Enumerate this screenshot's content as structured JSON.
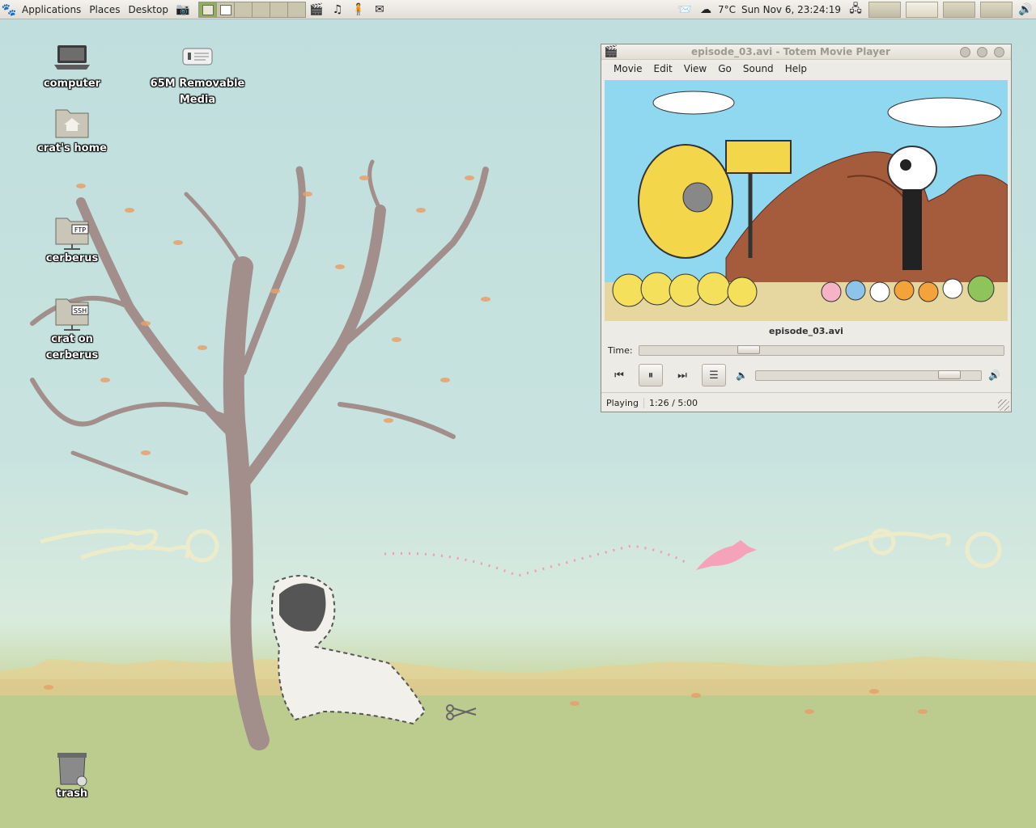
{
  "panel": {
    "menus": [
      "Applications",
      "Places",
      "Desktop"
    ],
    "weather": "7°C",
    "clock": "Sun Nov  6, 23:24:19"
  },
  "desktop_icons": [
    {
      "id": "computer",
      "label": "computer",
      "icon": "computer-icon"
    },
    {
      "id": "removable",
      "label": "65M Removable Media",
      "icon": "removable-drive-icon"
    },
    {
      "id": "home",
      "label": "crat's home",
      "icon": "home-folder-icon"
    },
    {
      "id": "cerberus",
      "label": "cerberus",
      "icon": "ftp-share-icon",
      "badge": "FTP"
    },
    {
      "id": "crat-cerberus",
      "label": "crat on cerberus",
      "icon": "ssh-share-icon",
      "badge": "SSH"
    },
    {
      "id": "trash",
      "label": "trash",
      "icon": "trash-icon"
    }
  ],
  "totem": {
    "title": "episode_03.avi - Totem Movie Player",
    "menu": [
      "Movie",
      "Edit",
      "View",
      "Go",
      "Sound",
      "Help"
    ],
    "filename": "episode_03.avi",
    "time_label": "Time:",
    "seek_fraction": 0.287,
    "volume_fraction": 0.9,
    "status_state": "Playing",
    "status_time": "1:26 / 5:00"
  },
  "colors": {
    "panel_bg": "#e2ded6",
    "workspace_active": "#8fae5f",
    "sky": "#c8e3df",
    "grass": "#bccb8e"
  }
}
